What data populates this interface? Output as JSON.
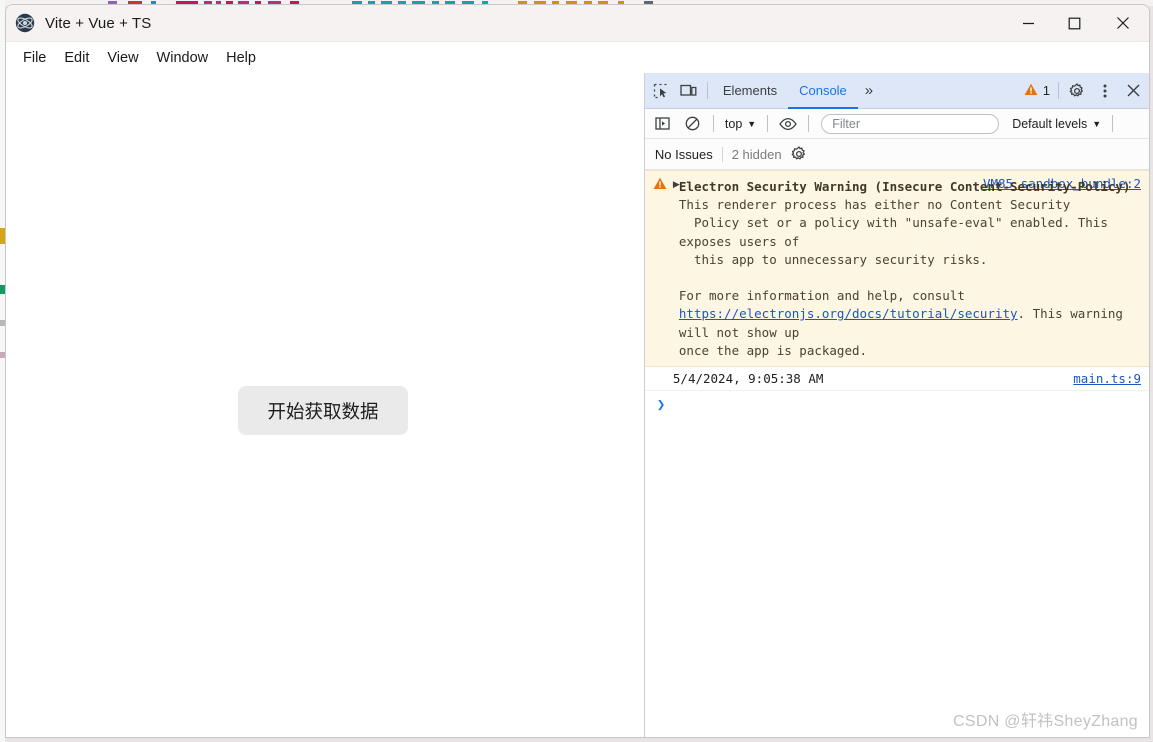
{
  "window": {
    "title": "Vite + Vue + TS",
    "app_icon": "electron-atom-icon",
    "controls": {
      "minimize": "—",
      "maximize": "▢",
      "close": "✕"
    }
  },
  "menubar": {
    "items": [
      {
        "label": "File"
      },
      {
        "label": "Edit"
      },
      {
        "label": "View"
      },
      {
        "label": "Window"
      },
      {
        "label": "Help"
      }
    ]
  },
  "page": {
    "fetch_button_label": "开始获取数据"
  },
  "devtools": {
    "toolbar": {
      "inspect_icon": "inspect-element-icon",
      "device_icon": "device-toolbar-icon",
      "tabs": [
        {
          "label": "Elements",
          "active": false
        },
        {
          "label": "Console",
          "active": true
        }
      ],
      "more_tabs": "»",
      "warning_count": "1",
      "warning_icon": "warning-triangle-icon",
      "settings_icon": "gear-icon",
      "kebab_icon": "more-vertical-icon",
      "close_icon": "close-icon"
    },
    "filterbar": {
      "sidebar_icon": "console-sidebar-icon",
      "clear_icon": "clear-console-icon",
      "context": "top",
      "eye_icon": "live-expression-icon",
      "filter_placeholder": "Filter",
      "filter_value": "",
      "levels": "Default levels"
    },
    "issuebar": {
      "no_issues": "No Issues",
      "hidden": "2 hidden",
      "settings_icon": "issues-settings-gear-icon"
    },
    "console": {
      "warning": {
        "source": "VM85 sandbox_bundle:2",
        "title": "Electron Security Warning (Insecure Content-Security-Policy)",
        "line1": "This renderer process has either no Content Security",
        "line2": "  Policy set or a policy with \"unsafe-eval\" enabled. This exposes users of",
        "line3": "  this app to unnecessary security risks.",
        "line4": "For more information and help, consult",
        "link": "https://electronjs.org/docs/tutorial/security",
        "line5": ". This warning will not show up",
        "line6": "once the app is packaged."
      },
      "log": {
        "message": "5/4/2024, 9:05:38 AM",
        "source": "main.ts:9"
      },
      "prompt_caret": "❯"
    }
  },
  "watermark": "CSDN @轩祎SheyZhang",
  "colors": {
    "accent": "#1a73e8",
    "warning_bg": "#fdf6e3",
    "warning_icon": "#e8710a",
    "link": "#1a56c4",
    "devtools_tabbar": "#dee7f7"
  }
}
